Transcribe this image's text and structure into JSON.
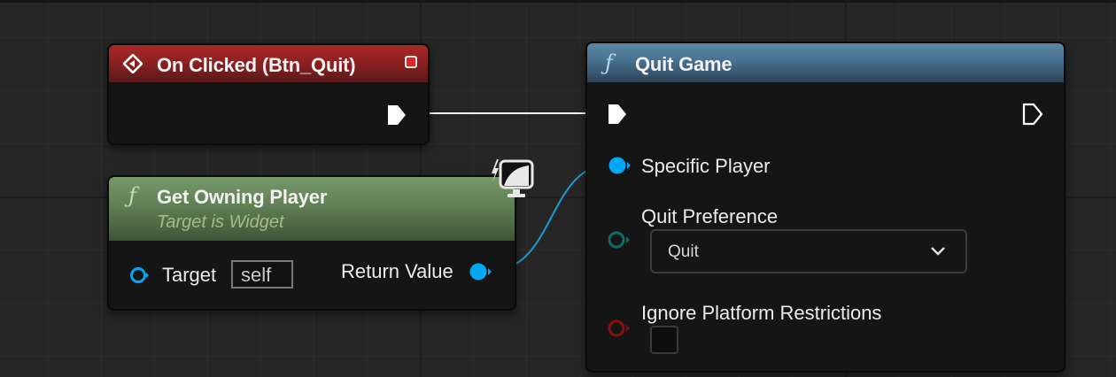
{
  "nodes": {
    "event": {
      "title": "On Clicked (Btn_Quit)"
    },
    "get_owning_player": {
      "title": "Get Owning Player",
      "subtitle": "Target is Widget",
      "target_label": "Target",
      "target_value": "self",
      "return_label": "Return Value"
    },
    "quit_game": {
      "title": "Quit Game",
      "specific_player_label": "Specific Player",
      "quit_preference_label": "Quit Preference",
      "quit_preference_value": "Quit",
      "ignore_restrictions_label": "Ignore Platform Restrictions",
      "ignore_restrictions_checked": false
    }
  },
  "icons": {
    "function": "ƒ",
    "event": "event-diamond-icon",
    "widget": "widget-monitor-icon",
    "exec_pin": "exec-arrow-icon",
    "object_pin": "object-pin-icon"
  },
  "colors": {
    "event_header": "#a82a2a",
    "pure_function_header": "#5d7c52",
    "function_header": "#48708f",
    "object_pin": "#00a8f4",
    "enum_pin": "#0d6b66",
    "bool_pin": "#8a1010",
    "exec_wire": "#ffffff",
    "object_wire": "#1a9ad6",
    "delegate_pin": "#e02424"
  }
}
